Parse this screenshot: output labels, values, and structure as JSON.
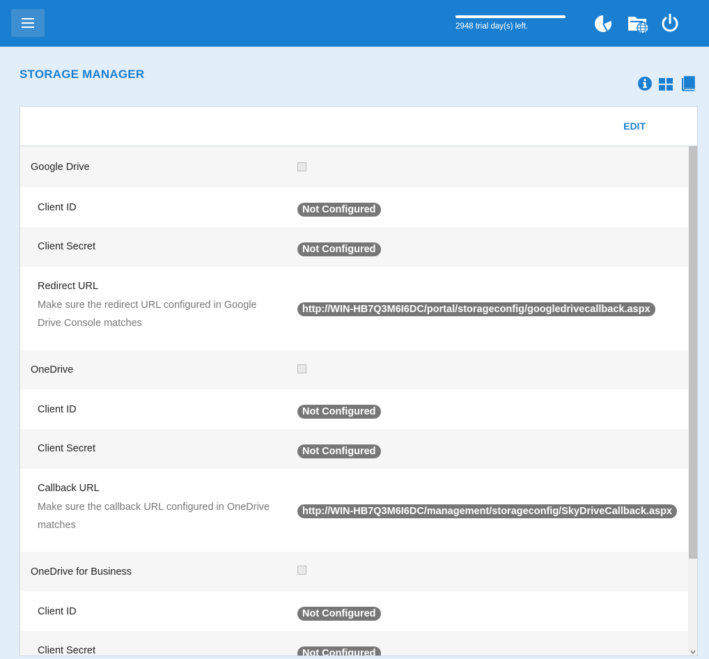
{
  "header": {
    "trial_text": "2948 trial day(s) left.",
    "trial_progress_percent": 100
  },
  "page": {
    "title": "STORAGE MANAGER",
    "edit_label": "EDIT"
  },
  "providers": [
    {
      "name": "Google Drive",
      "enabled": false,
      "fields": [
        {
          "label": "Client ID",
          "value": "Not Configured"
        },
        {
          "label": "Client Secret",
          "value": "Not Configured"
        },
        {
          "label": "Redirect URL",
          "note": "Make sure the redirect URL configured in Google Drive Console matches",
          "value": "http://WIN-HB7Q3M6I6DC/portal/storageconfig/googledrivecallback.aspx"
        }
      ]
    },
    {
      "name": "OneDrive",
      "enabled": false,
      "fields": [
        {
          "label": "Client ID",
          "value": "Not Configured"
        },
        {
          "label": "Client Secret",
          "value": "Not Configured"
        },
        {
          "label": "Callback URL",
          "note": "Make sure the callback URL configured in OneDrive matches",
          "value": "http://WIN-HB7Q3M6I6DC/management/storageconfig/SkyDriveCallback.aspx"
        }
      ]
    },
    {
      "name": "OneDrive for Business",
      "enabled": false,
      "fields": [
        {
          "label": "Client ID",
          "value": "Not Configured"
        },
        {
          "label": "Client Secret",
          "value": "Not Configured"
        }
      ]
    }
  ],
  "colors": {
    "brand": "#1a7fd0",
    "background": "#e2eef9",
    "pill": "#777777"
  },
  "icons": {
    "menu": "hamburger-menu-icon",
    "dashboard": "pie-chart-icon",
    "storage": "folder-globe-icon",
    "logout": "power-icon",
    "info": "info-icon",
    "grid": "grid-view-icon",
    "docs": "book-icon"
  }
}
